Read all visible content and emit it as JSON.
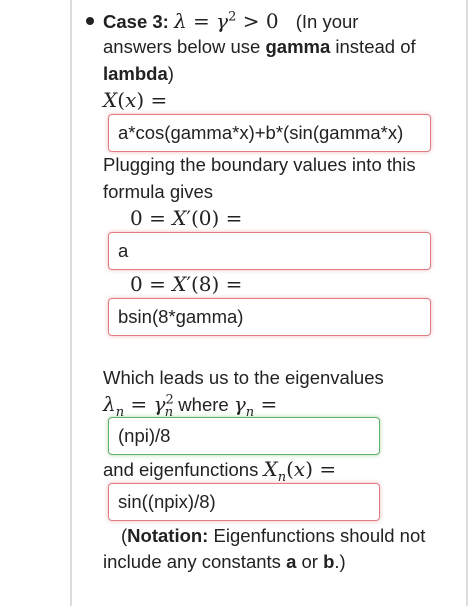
{
  "case": {
    "title": "Case 3:",
    "condition_math": "λ = γ² > 0",
    "note_prefix": "(In your",
    "note_line2_start": "answers below use ",
    "note_gamma": "gamma",
    "note_line2_end": " instead of",
    "note_lambda": "lambda",
    "note_close": ")"
  },
  "solution": {
    "label_math": "X(x) =",
    "answer": "a*cos(gamma*x)+b*(sin(gamma*x)"
  },
  "boundary": {
    "text_line1": "Plugging the boundary values into this",
    "text_line2": "formula gives",
    "first_label_math": "0 = X′(0) =",
    "first_answer": "a",
    "second_label_math": "0 = X′(8) =",
    "second_answer": "bsin(8*gamma)"
  },
  "eigen": {
    "intro": "Which leads us to the eigenvalues",
    "eigenvalue_math_lhs": "λn = γn²",
    "where_text": " where ",
    "gamma_n_math": "γn =",
    "gamma_answer": "(npi)/8",
    "functions_text": "and eigenfunctions ",
    "functions_math": "Xn(x) =",
    "functions_answer": "sin((npix)/8)"
  },
  "notation": {
    "open": "(",
    "label": "Notation:",
    "text_line1": " Eigenfunctions should not",
    "text_line2_start": "include any constants ",
    "const_a": "a",
    "or_text": " or ",
    "const_b": "b",
    "close": ".)"
  },
  "colors": {
    "invalid_border": "#e07d84",
    "valid_border": "#5fb25f"
  }
}
